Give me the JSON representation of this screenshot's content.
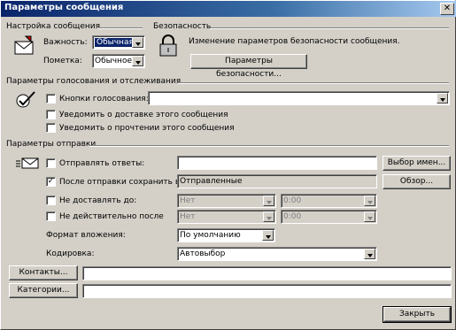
{
  "window": {
    "title": "Параметры сообщения",
    "close": "✕"
  },
  "settings": {
    "group_title": "Настройка сообщения",
    "importance_label": "Важность:",
    "importance_value": "Обычная",
    "sensitivity_label": "Пометка:",
    "sensitivity_value": "Обычное"
  },
  "security": {
    "group_title": "Безопасность",
    "description": "Изменение параметров безопасности сообщения.",
    "button": "Параметры безопасности..."
  },
  "voting": {
    "group_title": "Параметры голосования и отслеживания",
    "voting_buttons_label": "Кнопки голосования:",
    "voting_buttons_value": "",
    "delivery_receipt": "Уведомить о доставке этого сообщения",
    "read_receipt": "Уведомить о прочтении этого сообщения"
  },
  "delivery": {
    "group_title": "Параметры отправки",
    "replies_label": "Отправлять ответы:",
    "replies_value": "",
    "select_names_button": "Выбор имен...",
    "save_sent_label": "После отправки сохранить в:",
    "save_sent_value": "Отправленные",
    "browse_button": "Обзор...",
    "no_deliver_label": "Не доставлять до:",
    "no_deliver_date": "Нет",
    "no_deliver_time": "0:00",
    "expires_label": "Не действительно после",
    "expires_date": "Нет",
    "expires_time": "0:00",
    "attachment_format_label": "Формат вложения:",
    "attachment_format_value": "По умолчанию",
    "encoding_label": "Кодировка:",
    "encoding_value": "Автовыбор"
  },
  "contacts": {
    "button": "Контакты...",
    "value": ""
  },
  "categories": {
    "button": "Категории...",
    "value": ""
  },
  "close_button": "Закрыть",
  "checks": {
    "voting_buttons": false,
    "delivery_receipt": false,
    "read_receipt": false,
    "replies": false,
    "save_sent": true,
    "no_deliver": false,
    "expires": false
  }
}
